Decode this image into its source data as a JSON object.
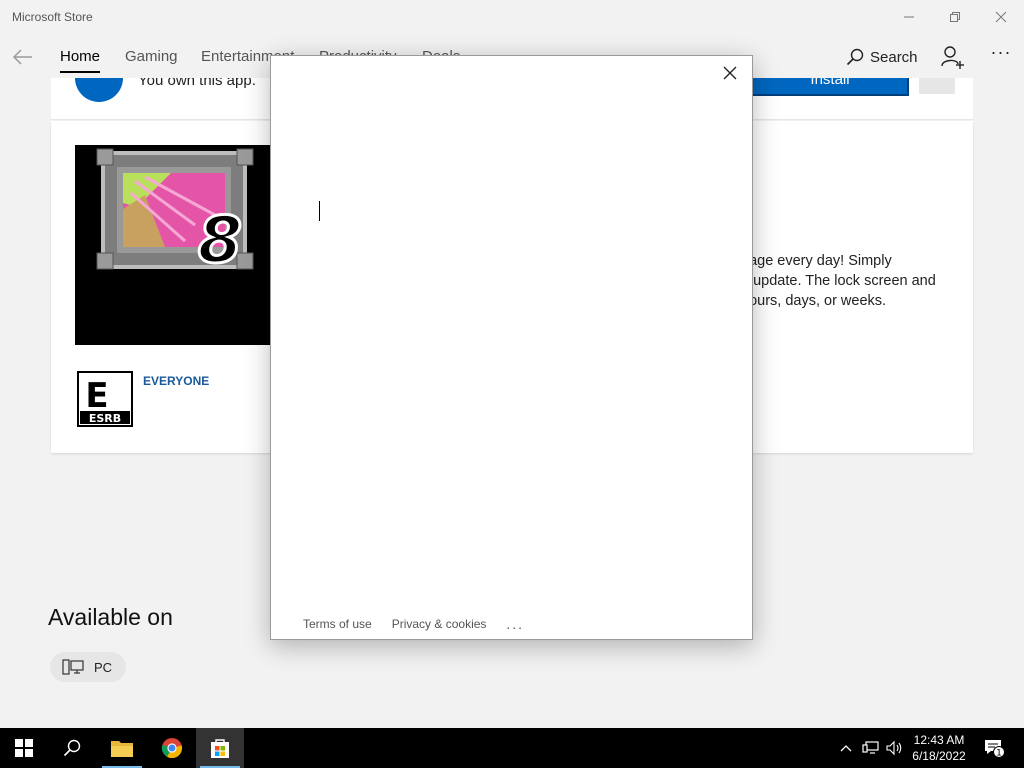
{
  "window": {
    "title": "Microsoft Store"
  },
  "nav": {
    "tabs": [
      {
        "label": "Home",
        "active": true
      },
      {
        "label": "Gaming"
      },
      {
        "label": "Entertainment"
      },
      {
        "label": "Productivity"
      },
      {
        "label": "Deals"
      }
    ],
    "search_label": "Search",
    "more_label": "···"
  },
  "own_card": {
    "status_text": "You own this app.",
    "install_label": "Install",
    "more_label": "···"
  },
  "product": {
    "logo_number": "8",
    "rating_text": "EVERYONE",
    "esrb_letter": "E",
    "esrb_caption": "ESRB",
    "description_lines": [
      "nage every day! Simply",
      "o update. The lock screen and",
      " hours, days, or weeks."
    ]
  },
  "available": {
    "heading": "Available on",
    "platform_label": "PC"
  },
  "modal": {
    "footer_links": [
      "Terms of use",
      "Privacy & cookies"
    ],
    "footer_more": "..."
  },
  "taskbar": {
    "time": "12:43 AM",
    "date": "6/18/2022",
    "notification_count": "1"
  },
  "colors": {
    "accent": "#0067c0",
    "background": "#f2f2f2",
    "taskbar": "#000000"
  }
}
